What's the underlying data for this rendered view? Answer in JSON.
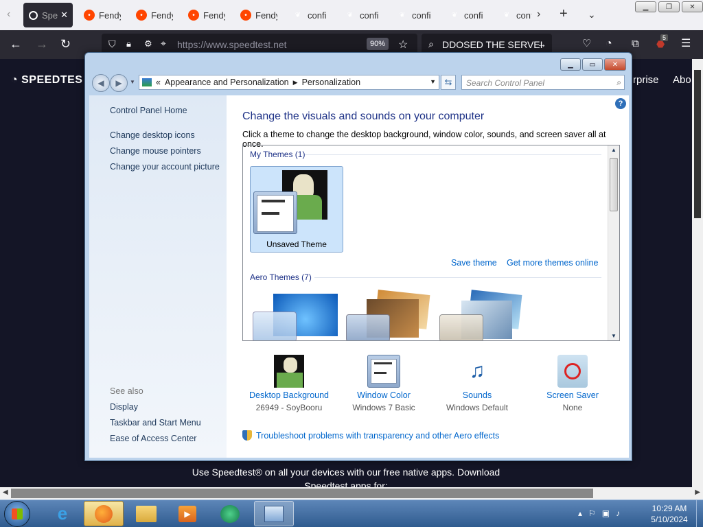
{
  "browser": {
    "tabs": [
      {
        "label": "Speedtest",
        "short": "Spe",
        "icon": "speedtest-icon",
        "active": true
      },
      {
        "label": "Fendy",
        "icon": "reddit-icon"
      },
      {
        "label": "Fendy",
        "icon": "reddit-icon"
      },
      {
        "label": "Fendy",
        "icon": "reddit-icon"
      },
      {
        "label": "Fendy",
        "icon": "reddit-icon"
      },
      {
        "label": "confi",
        "icon": "green-leaf-icon"
      },
      {
        "label": "confi",
        "icon": "green-leaf-icon"
      },
      {
        "label": "confi",
        "icon": "green-leaf-icon"
      },
      {
        "label": "confi",
        "icon": "green-leaf-icon"
      },
      {
        "label": "conf",
        "icon": "green-leaf-icon"
      }
    ],
    "url": "https://www.speedtest.net",
    "zoom": "90%",
    "search_text": "DDOSED THE SERVEI",
    "extension_badge": "5"
  },
  "page": {
    "logo": "SPEEDTES",
    "nav": [
      "rprise",
      "Abo"
    ],
    "promo_line1": "Use Speedtest® on all your devices with our free native apps. Download",
    "promo_line2": "Speedtest apps for:"
  },
  "control_panel": {
    "breadcrumb": [
      "Appearance and Personalization",
      "Personalization"
    ],
    "search_placeholder": "Search Control Panel",
    "sidebar": {
      "home": "Control Panel Home",
      "links": [
        "Change desktop icons",
        "Change mouse pointers",
        "Change your account picture"
      ],
      "see_also_title": "See also",
      "see_also": [
        "Display",
        "Taskbar and Start Menu",
        "Ease of Access Center"
      ]
    },
    "title": "Change the visuals and sounds on your computer",
    "description": "Click a theme to change the desktop background, window color, sounds, and screen saver all at once.",
    "my_themes_label": "My Themes (1)",
    "unsaved_theme": "Unsaved Theme",
    "save_theme": "Save theme",
    "get_more": "Get more themes online",
    "aero_themes_label": "Aero Themes (7)",
    "bottom": [
      {
        "label": "Desktop Background",
        "sub": "26949 - SoyBooru",
        "icon": "desktop-background-icon"
      },
      {
        "label": "Window Color",
        "sub": "Windows 7 Basic",
        "icon": "window-color-icon"
      },
      {
        "label": "Sounds",
        "sub": "Windows Default",
        "icon": "sounds-icon"
      },
      {
        "label": "Screen Saver",
        "sub": "None",
        "icon": "screen-saver-icon"
      }
    ],
    "troubleshoot": "Troubleshoot problems with transparency and other Aero effects"
  },
  "taskbar": {
    "time": "10:29 AM",
    "date": "5/10/2024"
  }
}
